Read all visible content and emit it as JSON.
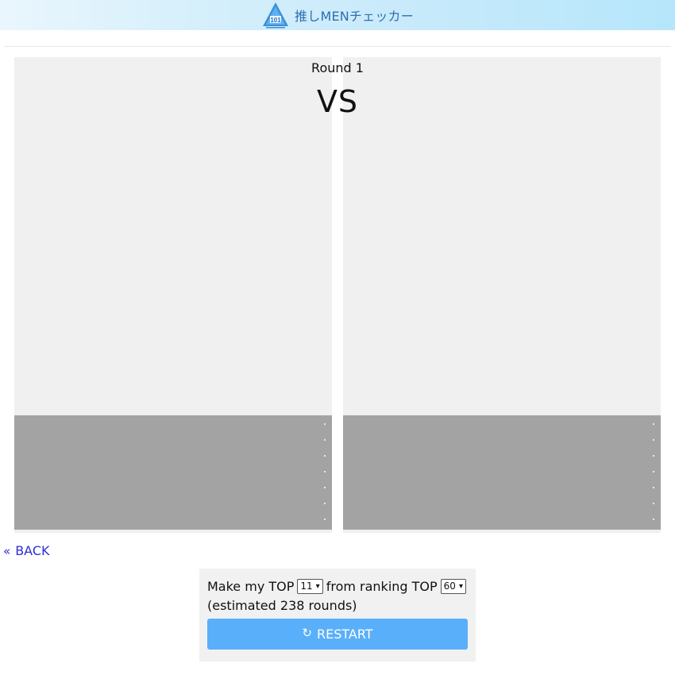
{
  "header": {
    "title": "推しMENチェッカー",
    "logo_icon": "produce-101-logo-icon",
    "logo_text": "101"
  },
  "battle": {
    "round_label": "Round 1",
    "vs_label": "VS"
  },
  "nav": {
    "back_icon": "double-chevron-left-icon",
    "back_label": "BACK"
  },
  "settings": {
    "make_top_prefix": "Make my TOP",
    "top_count": "11",
    "from_ranking_label": "from ranking TOP",
    "ranking_count": "60",
    "estimate_text": "(estimated 238 rounds)",
    "restart_icon": "refresh-icon",
    "restart_label": "RESTART"
  },
  "colors": {
    "header_gradient_end": "#b6e6fb",
    "title_color": "#2e6fb1",
    "card_info_bg": "#a3a3a3",
    "restart_bg": "#5aaffa",
    "link_color": "#2c2cd4"
  }
}
